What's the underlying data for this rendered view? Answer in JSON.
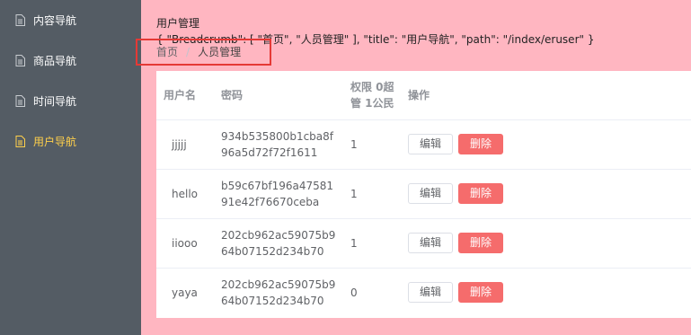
{
  "sidebar": {
    "items": [
      {
        "label": "内容导航",
        "icon": "document-icon",
        "active": false
      },
      {
        "label": "商品导航",
        "icon": "document-icon",
        "active": false
      },
      {
        "label": "时间导航",
        "icon": "document-icon",
        "active": false
      },
      {
        "label": "用户导航",
        "icon": "document-icon",
        "active": true
      }
    ]
  },
  "main": {
    "title": "用户管理",
    "raw_data": "{ \"Breadcrumb\": [ \"首页\", \"人员管理\" ], \"title\": \"用户导航\", \"path\": \"/index/eruser\" }",
    "breadcrumb": {
      "items": [
        "首页",
        "人员管理"
      ],
      "separator": "/"
    }
  },
  "table": {
    "headers": {
      "name": "用户名",
      "password": "密码",
      "permission": "权限 0超管 1公民",
      "actions": "操作"
    },
    "rows": [
      {
        "name": "jjjjj",
        "password": "934b535800b1cba8f96a5d72f72f1611",
        "permission": "1"
      },
      {
        "name": "hello",
        "password": "b59c67bf196a4758191e42f76670ceba",
        "permission": "1"
      },
      {
        "name": "iiooo",
        "password": "202cb962ac59075b964b07152d234b70",
        "permission": "1"
      },
      {
        "name": "yaya",
        "password": "202cb962ac59075b964b07152d234b70",
        "permission": "0"
      }
    ],
    "edit_label": "编辑",
    "delete_label": "删除"
  },
  "colors": {
    "sidebar_bg": "#545c64",
    "sidebar_active": "#ffd04b",
    "main_bg": "#ffb6c1",
    "delete_button": "#f56c6c",
    "highlight_box": "#e53935"
  }
}
